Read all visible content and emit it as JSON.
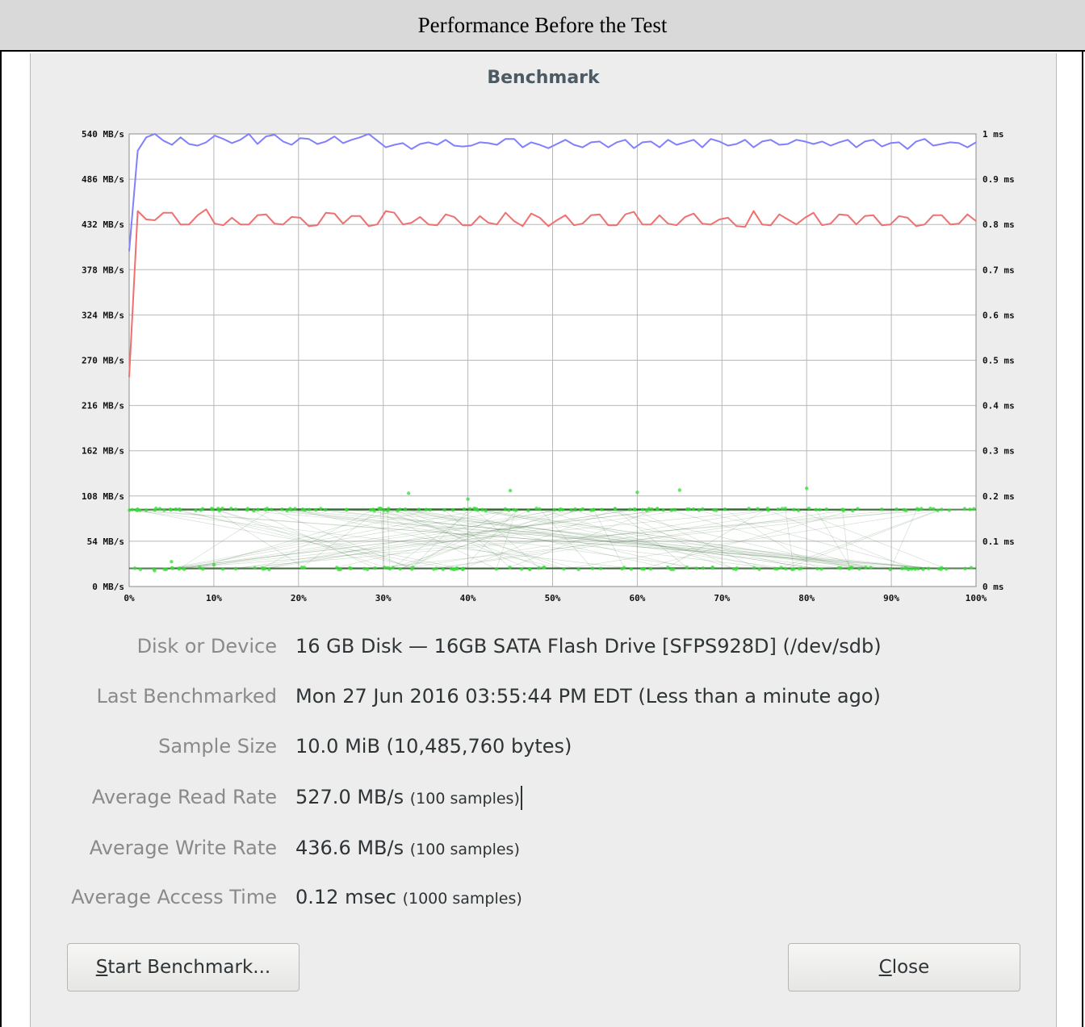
{
  "caption": "Performance Before the Test",
  "dialog": {
    "title": "Benchmark"
  },
  "chart_data": {
    "type": "line",
    "left_axis_ticks": [
      "540 MB/s",
      "486 MB/s",
      "432 MB/s",
      "378 MB/s",
      "324 MB/s",
      "270 MB/s",
      "216 MB/s",
      "162 MB/s",
      "108 MB/s",
      "54 MB/s",
      "0 MB/s"
    ],
    "right_axis_ticks": [
      "1 ms",
      "0.9 ms",
      "0.8 ms",
      "0.7 ms",
      "0.6 ms",
      "0.5 ms",
      "0.4 ms",
      "0.3 ms",
      "0.2 ms",
      "0.1 ms",
      "0 ms"
    ],
    "x_ticks": [
      "0%",
      "10%",
      "20%",
      "30%",
      "40%",
      "50%",
      "60%",
      "70%",
      "80%",
      "90%",
      "100%"
    ],
    "ylim_rate": [
      0,
      540
    ],
    "ylim_time": [
      0,
      1
    ],
    "xlim": [
      0,
      100
    ],
    "grid": true,
    "series": [
      {
        "color": "#8080ff",
        "values": [
          400,
          520,
          536,
          540,
          532,
          527,
          536,
          528,
          526,
          530,
          538,
          534,
          529,
          533,
          540,
          528,
          537,
          539,
          531,
          527,
          535,
          534,
          528,
          531,
          537,
          529,
          533,
          536,
          540,
          532,
          524,
          527,
          529,
          522,
          528,
          530,
          527,
          533,
          526,
          525,
          526,
          530,
          529,
          527,
          534,
          534,
          524,
          530,
          527,
          523,
          528,
          533,
          527,
          524,
          530,
          531,
          524,
          530,
          533,
          523,
          530,
          531,
          524,
          533,
          527,
          530,
          533,
          524,
          534,
          531,
          526,
          528,
          533,
          524,
          531,
          533,
          527,
          528,
          533,
          531,
          528,
          531,
          526,
          530,
          533,
          524,
          531,
          533,
          525,
          529,
          530,
          522,
          531,
          534,
          526,
          528,
          530,
          529,
          524,
          530
        ]
      },
      {
        "color": "#f07070",
        "values": [
          250,
          448,
          438,
          437,
          446,
          446,
          432,
          432,
          443,
          450,
          433,
          431,
          440,
          432,
          432,
          443,
          444,
          433,
          432,
          441,
          440,
          430,
          431,
          446,
          445,
          433,
          442,
          442,
          430,
          432,
          448,
          446,
          432,
          434,
          441,
          432,
          431,
          444,
          441,
          431,
          431,
          442,
          434,
          432,
          446,
          436,
          430,
          445,
          440,
          430,
          437,
          443,
          431,
          433,
          443,
          444,
          431,
          431,
          444,
          447,
          432,
          432,
          443,
          433,
          431,
          441,
          445,
          433,
          432,
          438,
          440,
          430,
          429,
          448,
          432,
          431,
          444,
          438,
          432,
          440,
          446,
          431,
          433,
          444,
          443,
          432,
          442,
          443,
          431,
          432,
          442,
          440,
          430,
          432,
          443,
          443,
          432,
          433,
          444,
          436
        ]
      }
    ],
    "access_time": {
      "color": "#33dd33",
      "cluster_levels_ms": [
        0.17,
        0.04
      ],
      "samples": 1000
    }
  },
  "info": {
    "rows": [
      {
        "label": "Disk or Device",
        "value": "16 GB Disk — 16GB SATA Flash Drive [SFPS928D] (/dev/sdb)",
        "sub": ""
      },
      {
        "label": "Last Benchmarked",
        "value": "Mon 27 Jun 2016 03:55:44 PM EDT (Less than a minute ago)",
        "sub": ""
      },
      {
        "label": "Sample Size",
        "value": "10.0 MiB (10,485,760 bytes)",
        "sub": ""
      },
      {
        "label": "Average Read Rate",
        "value": "527.0 MB/s",
        "sub": "(100 samples)"
      },
      {
        "label": "Average Write Rate",
        "value": "436.6 MB/s",
        "sub": "(100 samples)"
      },
      {
        "label": "Average Access Time",
        "value": "0.12 msec",
        "sub": "(1000 samples)"
      }
    ]
  },
  "buttons": {
    "start": {
      "mnemonic": "S",
      "rest": "tart Benchmark..."
    },
    "close": {
      "mnemonic": "C",
      "rest": "lose"
    }
  }
}
